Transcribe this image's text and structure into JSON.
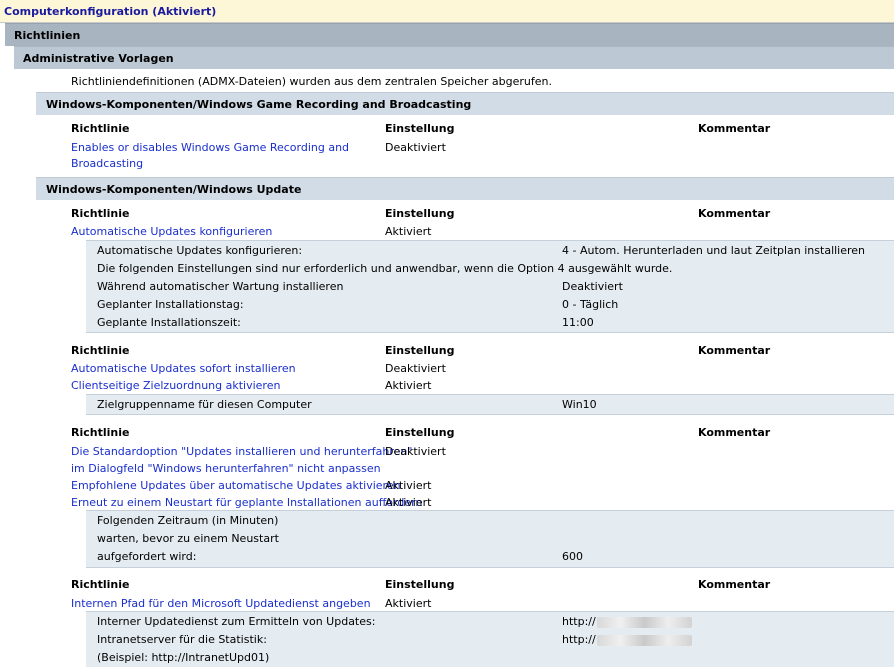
{
  "header": {
    "title": "Computerkonfiguration (Aktiviert)"
  },
  "sections": {
    "richtlinien": "Richtlinien",
    "admin_templates": "Administrative Vorlagen",
    "admx_note": "Richtliniendefinitionen (ADMX-Dateien) wurden aus dem zentralen Speicher abgerufen.",
    "game_recording": "Windows-Komponenten/Windows Game Recording and Broadcasting",
    "windows_update": "Windows-Komponenten/Windows Update"
  },
  "columns": {
    "policy": "Richtlinie",
    "setting": "Einstellung",
    "comment": "Kommentar"
  },
  "game_policy": {
    "name_line1": "Enables or disables Windows Game Recording and",
    "name_line2": "Broadcasting",
    "setting": "Deaktiviert"
  },
  "wu": {
    "p1": {
      "name": "Automatische Updates konfigurieren",
      "setting": "Aktiviert"
    },
    "p1_details": [
      {
        "label": "Automatische Updates konfigurieren:",
        "value": "4 - Autom. Herunterladen und laut Zeitplan installieren"
      },
      {
        "label": "Die folgenden Einstellungen sind nur erforderlich und anwendbar, wenn die Option 4 ausgewählt wurde.",
        "value": ""
      },
      {
        "label": "Während automatischer Wartung installieren",
        "value": "Deaktiviert"
      },
      {
        "label": "Geplanter Installationstag:",
        "value": "0 - Täglich"
      },
      {
        "label": "Geplante Installationszeit:",
        "value": "11:00"
      }
    ],
    "p2": {
      "name": "Automatische Updates sofort installieren",
      "setting": "Deaktiviert"
    },
    "p3": {
      "name": "Clientseitige Zielzuordnung aktivieren",
      "setting": "Aktiviert"
    },
    "p3_detail": {
      "label": "Zielgruppenname für diesen Computer",
      "value": "Win10"
    },
    "p4": {
      "name_line1": "Die Standardoption \"Updates installieren und herunterfahren\"",
      "name_line2": "im Dialogfeld \"Windows herunterfahren\" nicht anpassen",
      "setting": "Deaktiviert"
    },
    "p5": {
      "name": "Empfohlene Updates über automatische Updates aktivieren",
      "setting": "Aktiviert"
    },
    "p6": {
      "name": "Erneut zu einem Neustart für geplante Installationen auffordern",
      "setting": "Aktiviert"
    },
    "p6_detail": {
      "line1": "Folgenden Zeitraum (in Minuten)",
      "line2": "warten, bevor zu einem Neustart",
      "line3": "aufgefordert wird:",
      "value": "600"
    },
    "p7": {
      "name": "Internen Pfad für den Microsoft Updatedienst angeben",
      "setting": "Aktiviert"
    },
    "p7_details": {
      "label1": "Interner Updatedienst zum Ermitteln von Updates:",
      "value1": "http://",
      "label2": "Intranetserver für die Statistik:",
      "value2": "http://",
      "label3": "(Beispiel: http://IntranetUpd01)"
    }
  }
}
